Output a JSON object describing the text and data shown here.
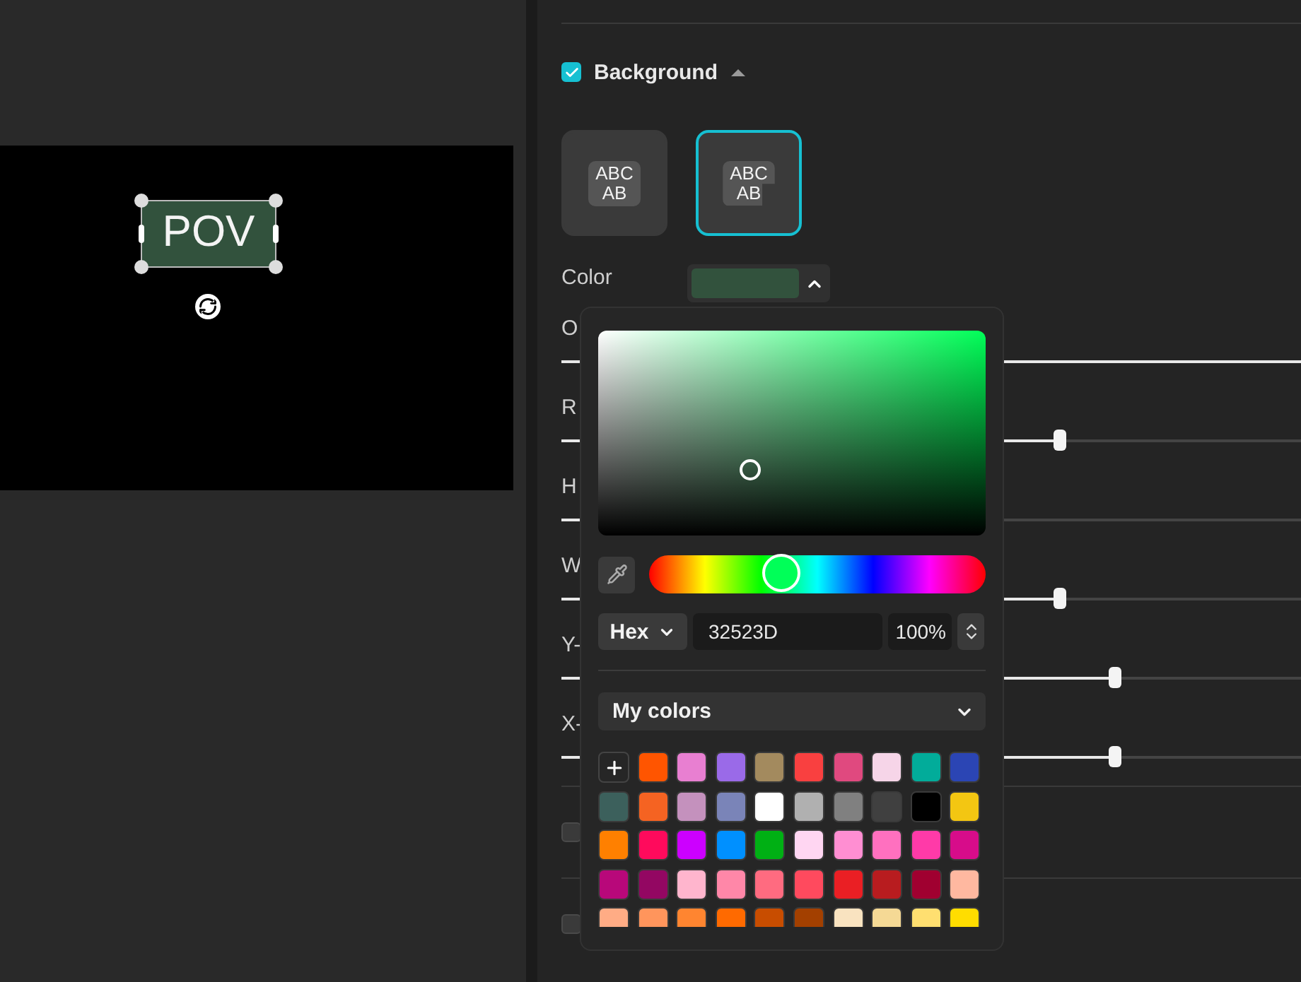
{
  "canvas": {
    "caption": {
      "text": "POV",
      "color": "#32523d"
    }
  },
  "background": {
    "label": "Background",
    "checked": true,
    "expanded": true
  },
  "presets": [
    {
      "kind": "rect",
      "lines": [
        "ABC",
        "AB"
      ],
      "selected": false
    },
    {
      "kind": "notched",
      "lines": [
        "ABC",
        "AB"
      ],
      "selected": true
    }
  ],
  "color": {
    "label": "Color",
    "open": true
  },
  "sliders": [
    {
      "label": "O",
      "level": 1
    },
    {
      "label": "R",
      "level": 0.675
    },
    {
      "label": "H",
      "level": 0.3
    },
    {
      "label": "W",
      "level": 0.675
    },
    {
      "label": "Y-",
      "level": 0.75
    },
    {
      "label": "X-",
      "level": 0.75
    }
  ],
  "sections": [
    {
      "checked": false
    },
    {
      "checked": false
    }
  ],
  "picker": {
    "format": "Hex",
    "hex": "32523D",
    "alpha": "100%",
    "palette": "My colors",
    "swatches": [
      {
        "color": "#ff5500"
      },
      {
        "color": "#e87fd1"
      },
      {
        "color": "#9a6ae8"
      },
      {
        "color": "#a38a5e"
      },
      {
        "color": "#f94040"
      },
      {
        "color": "#e0497f"
      },
      {
        "color": "#f6d5e8"
      },
      {
        "color": "#02ac9a"
      },
      {
        "color": "#2b45b4"
      },
      {
        "color": "#3c605c"
      },
      {
        "color": "#f56322"
      },
      {
        "color": "#c491bd"
      },
      {
        "color": "#7a84b8"
      },
      {
        "color": "#ffffff"
      },
      {
        "color": "#b0b0b0"
      },
      {
        "color": "#808080"
      },
      {
        "color": "#404040"
      },
      {
        "color": "#000000"
      },
      {
        "color": "#f3c612"
      },
      {
        "color": "#ff8000"
      },
      {
        "color": "#ff0a5c"
      },
      {
        "color": "#cc00ff"
      },
      {
        "color": "#0090ff"
      },
      {
        "color": "#00b014"
      },
      {
        "color": "#ffd6f2"
      },
      {
        "color": "#ff8ed2"
      },
      {
        "color": "#ff70bf"
      },
      {
        "color": "#ff3aa8"
      },
      {
        "color": "#d70c8a"
      },
      {
        "color": "#b8087a"
      },
      {
        "color": "#930762"
      },
      {
        "color": "#ffb5cd"
      },
      {
        "color": "#ff87a8"
      },
      {
        "color": "#ff6b80"
      },
      {
        "color": "#ff4a5e"
      },
      {
        "color": "#ea1f24"
      },
      {
        "color": "#b81c1f"
      },
      {
        "color": "#a00030"
      },
      {
        "color": "#ffb8a0"
      },
      {
        "color": "#ffac85"
      },
      {
        "color": "#ff955c"
      },
      {
        "color": "#ff8530"
      },
      {
        "color": "#ff6a00"
      },
      {
        "color": "#c84d00"
      },
      {
        "color": "#a34000"
      },
      {
        "color": "#f9e3c0"
      },
      {
        "color": "#f5d995"
      },
      {
        "color": "#ffdf70"
      },
      {
        "color": "#ffdd00"
      }
    ]
  }
}
